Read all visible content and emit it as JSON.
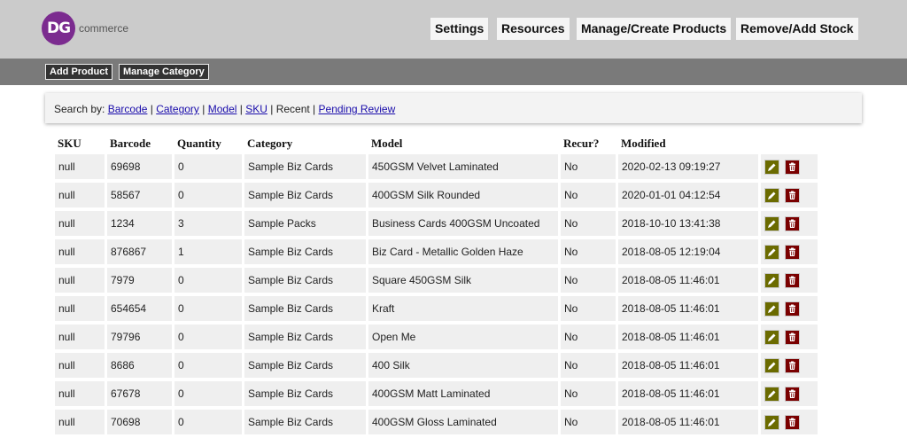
{
  "brand": {
    "logo_initials": "DG",
    "logo_text": "commerce",
    "logo_color": "#7b2b8f"
  },
  "nav": {
    "settings": "Settings",
    "resources": "Resources",
    "manage_products": "Manage/Create Products",
    "stock": "Remove/Add Stock"
  },
  "subnav": {
    "add_product": "Add Product",
    "manage_category": "Manage Category"
  },
  "search": {
    "label": "Search by:",
    "barcode": "Barcode",
    "category": "Category",
    "model": "Model",
    "sku": "SKU",
    "recent": "Recent",
    "pending": "Pending Review"
  },
  "table": {
    "headers": [
      "SKU",
      "Barcode",
      "Quantity",
      "Category",
      "Model",
      "Recur?",
      "Modified"
    ],
    "rows": [
      [
        "null",
        "69698",
        "0",
        "Sample Biz Cards",
        "450GSM Velvet Laminated",
        "No",
        "2020-02-13 09:19:27"
      ],
      [
        "null",
        "58567",
        "0",
        "Sample Biz Cards",
        "400GSM Silk Rounded",
        "No",
        "2020-01-01 04:12:54"
      ],
      [
        "null",
        "1234",
        "3",
        "Sample Packs",
        "Business Cards 400GSM Uncoated",
        "No",
        "2018-10-10 13:41:38"
      ],
      [
        "null",
        "876867",
        "1",
        "Sample Biz Cards",
        "Biz Card - Metallic Golden Haze",
        "No",
        "2018-08-05 12:19:04"
      ],
      [
        "null",
        "7979",
        "0",
        "Sample Biz Cards",
        "Square 450GSM Silk",
        "No",
        "2018-08-05 11:46:01"
      ],
      [
        "null",
        "654654",
        "0",
        "Sample Biz Cards",
        "Kraft",
        "No",
        "2018-08-05 11:46:01"
      ],
      [
        "null",
        "79796",
        "0",
        "Sample Biz Cards",
        "Open Me",
        "No",
        "2018-08-05 11:46:01"
      ],
      [
        "null",
        "8686",
        "0",
        "Sample Biz Cards",
        "400 Silk",
        "No",
        "2018-08-05 11:46:01"
      ],
      [
        "null",
        "67678",
        "0",
        "Sample Biz Cards",
        "400GSM Matt Laminated",
        "No",
        "2018-08-05 11:46:01"
      ],
      [
        "null",
        "70698",
        "0",
        "Sample Biz Cards",
        "400GSM Gloss Laminated",
        "No",
        "2018-08-05 11:46:01"
      ]
    ]
  },
  "icons": {
    "edit": "pencil-icon",
    "delete": "trash-icon"
  },
  "colors": {
    "edit_button": "#6b6b00",
    "delete_button": "#7a0000",
    "header_bg": "#cbcbcb",
    "subbar_bg": "#7a7a7a"
  }
}
